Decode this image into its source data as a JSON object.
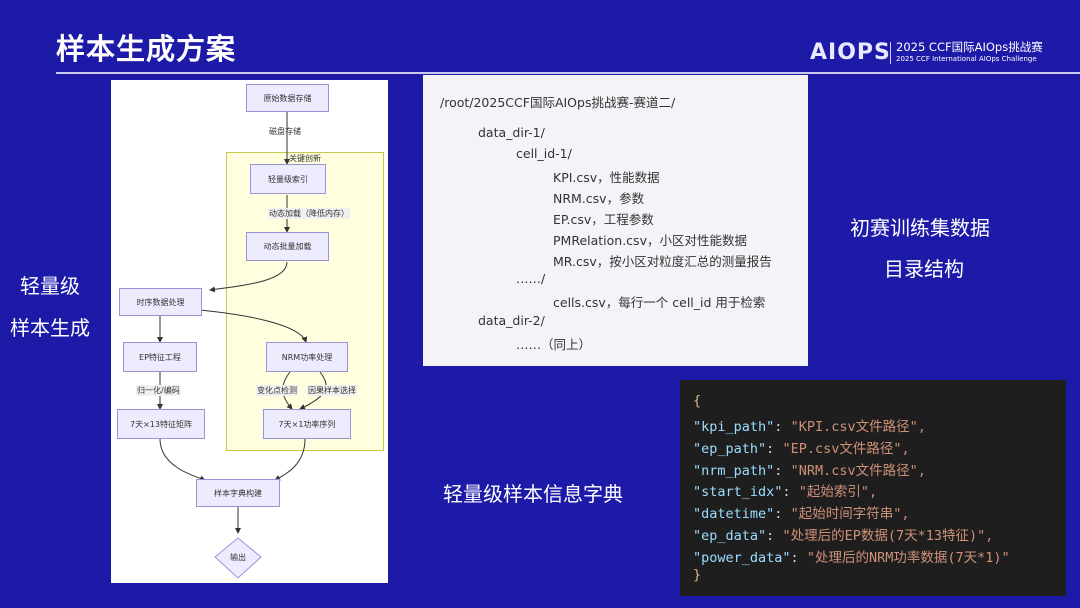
{
  "title": "样本生成方案",
  "header": {
    "logo": "AIOPS",
    "competition_title": "2025 CCF国际AIOps挑战赛",
    "competition_subtitle": "2025 CCF International AIOps Challenge"
  },
  "left_label": {
    "line1": "轻量级",
    "line2": "样本生成"
  },
  "flowchart": {
    "nodes": {
      "raw_storage": "原始数据存储",
      "light_index": "轻量级索引",
      "dynamic_batch": "动态批量加载",
      "ts_process": "时序数据处理",
      "ep_feature": "EP特征工程",
      "nrm_power": "NRM功率处理",
      "ep_matrix": "7天×13特征矩阵",
      "power_seq": "7天×1功率序列",
      "dict_build": "样本字典构建",
      "output": "输出"
    },
    "edges": {
      "disk": "磁盘存储",
      "key_innovation": "关键创新",
      "dynamic_load": "动态加载（降低内存）",
      "normalize": "归一化/编码",
      "change_point": "变化点检测",
      "causal": "因果样本选择"
    }
  },
  "directory": {
    "lines": [
      "/root/2025CCF国际AIOps挑战赛-赛道二/",
      "data_dir-1/",
      "cell_id-1/",
      "KPI.csv，性能数据",
      "NRM.csv，参数",
      "EP.csv，工程参数",
      "PMRelation.csv，小区对性能数据",
      "MR.csv，按小区对粒度汇总的测量报告",
      "……/",
      "cells.csv，每行一个 cell_id 用于检索",
      "data_dir-2/",
      "……（同上）"
    ]
  },
  "right_caption": {
    "line1": "初赛训练集数据",
    "line2": "目录结构"
  },
  "dict_caption": "轻量级样本信息字典",
  "code": {
    "open": "{",
    "close": "}",
    "entries": [
      {
        "key": "\"kpi_path\"",
        "value": "\"KPI.csv文件路径\","
      },
      {
        "key": "\"ep_path\"",
        "value": "\"EP.csv文件路径\","
      },
      {
        "key": "\"nrm_path\"",
        "value": "\"NRM.csv文件路径\","
      },
      {
        "key": "\"start_idx\"",
        "value": "\"起始索引\","
      },
      {
        "key": "\"datetime\"",
        "value": "\"起始时间字符串\","
      },
      {
        "key": "\"ep_data\"",
        "value": "\"处理后的EP数据(7天*13特征)\","
      },
      {
        "key": "\"power_data\"",
        "value": "\"处理后的NRM功率数据(7天*1)\""
      }
    ],
    "colon": ":"
  }
}
